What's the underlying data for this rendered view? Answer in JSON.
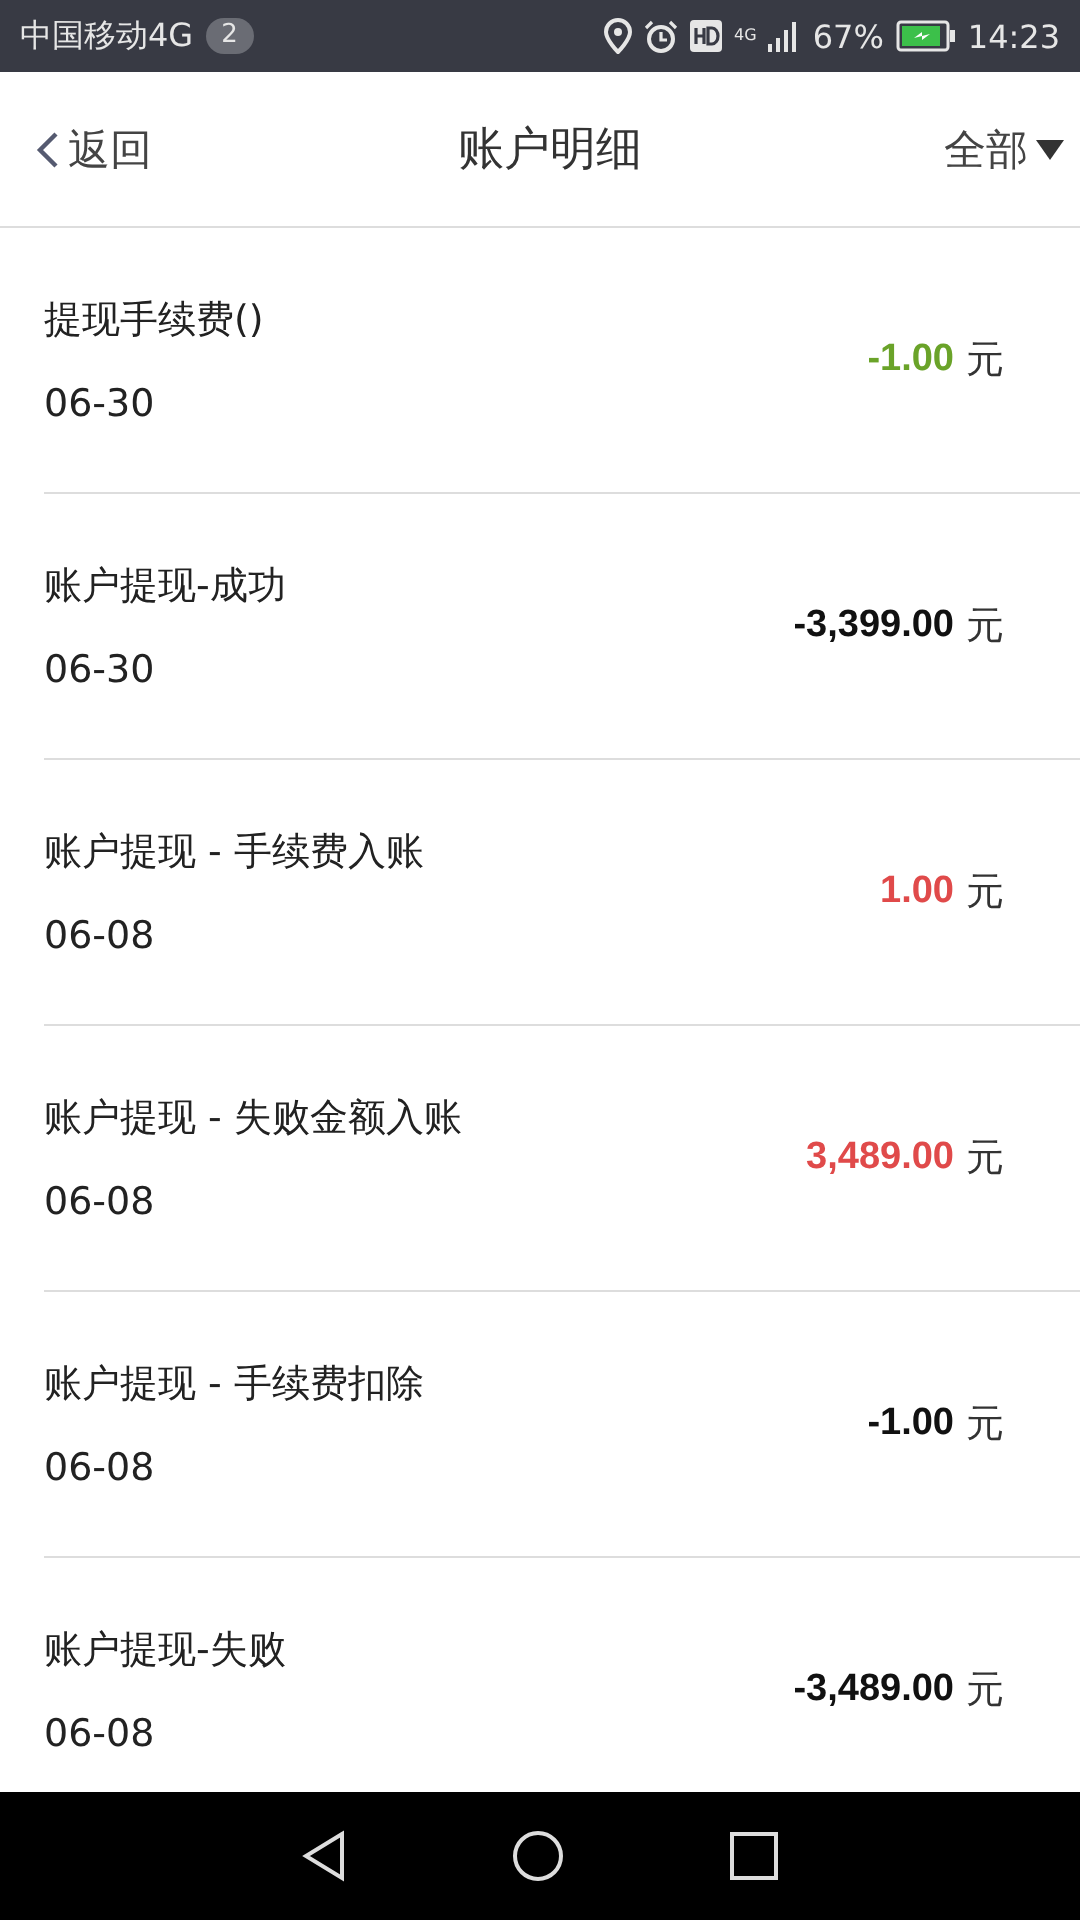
{
  "status_bar": {
    "carrier": "中国移动4G",
    "notification_count": "2",
    "network": "4G",
    "battery_percent": "67%",
    "time": "14:23"
  },
  "header": {
    "back_label": "返回",
    "title": "账户明细",
    "filter_label": "全部"
  },
  "transactions": [
    {
      "title": "提现手续费()",
      "date": "06-30",
      "amount": "-1.00",
      "unit": "元",
      "color": "#6aa329"
    },
    {
      "title": "账户提现-成功",
      "date": "06-30",
      "amount": "-3,399.00",
      "unit": "元",
      "color": "#111111"
    },
    {
      "title": "账户提现 - 手续费入账",
      "date": "06-08",
      "amount": "1.00",
      "unit": "元",
      "color": "#e04a4a"
    },
    {
      "title": "账户提现 - 失败金额入账",
      "date": "06-08",
      "amount": "3,489.00",
      "unit": "元",
      "color": "#e04a4a"
    },
    {
      "title": "账户提现 - 手续费扣除",
      "date": "06-08",
      "amount": "-1.00",
      "unit": "元",
      "color": "#111111"
    },
    {
      "title": "账户提现-失败",
      "date": "06-08",
      "amount": "-3,489.00",
      "unit": "元",
      "color": "#111111"
    }
  ]
}
